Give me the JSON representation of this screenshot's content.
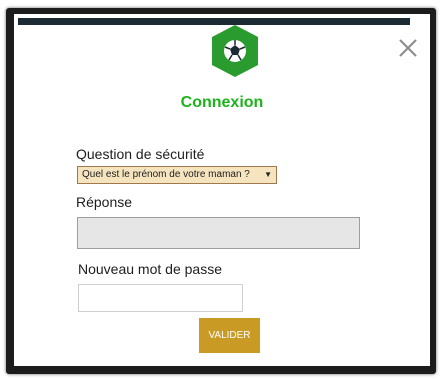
{
  "dialog": {
    "title": "Connexion",
    "close_symbol": "×",
    "logo_icon": "soccer-ball-icon",
    "accent_color": "#1db31d",
    "bar_color": "#1b2a33"
  },
  "form": {
    "security_question_label": "Question de sécurité",
    "security_question_selected": "Quel est le prénom de votre maman ?",
    "security_question_chevron": "▼",
    "answer_label": "Réponse",
    "answer_value": "",
    "new_password_label": "Nouveau mot de passe",
    "new_password_value": "",
    "submit_label": "VALIDER",
    "submit_color": "#c99b24"
  }
}
